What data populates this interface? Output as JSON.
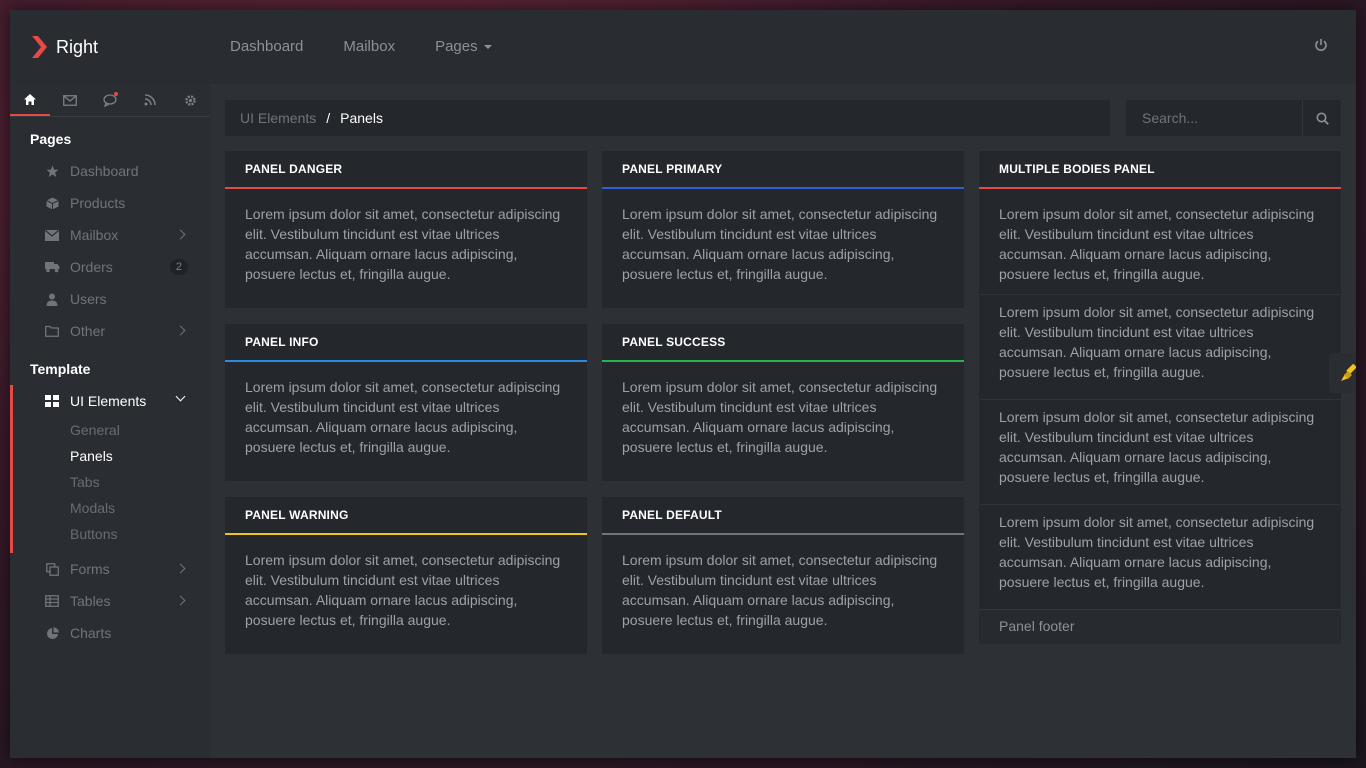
{
  "brand": {
    "name": "Right"
  },
  "topnav": {
    "items": [
      "Dashboard",
      "Mailbox",
      "Pages"
    ]
  },
  "sidebar": {
    "tabs": [
      "home-icon",
      "envelope-icon",
      "chat-icon",
      "rss-icon",
      "gear-icon"
    ],
    "pages_heading": "Pages",
    "pages": [
      {
        "label": "Dashboard",
        "icon": "star-icon"
      },
      {
        "label": "Products",
        "icon": "cube-icon"
      },
      {
        "label": "Mailbox",
        "icon": "envelope-icon",
        "chevron": true
      },
      {
        "label": "Orders",
        "icon": "truck-icon",
        "badge": "2"
      },
      {
        "label": "Users",
        "icon": "user-icon"
      },
      {
        "label": "Other",
        "icon": "folder-icon",
        "chevron": true
      }
    ],
    "template_heading": "Template",
    "ui_elements": {
      "label": "UI Elements",
      "children": [
        "General",
        "Panels",
        "Tabs",
        "Modals",
        "Buttons"
      ],
      "active_child": "Panels"
    },
    "template_items": [
      {
        "label": "Forms",
        "icon": "copy-icon",
        "chevron": true
      },
      {
        "label": "Tables",
        "icon": "table-icon",
        "chevron": true
      },
      {
        "label": "Charts",
        "icon": "pie-chart-icon"
      }
    ]
  },
  "breadcrumb": {
    "parent": "UI Elements",
    "separator": "/",
    "current": "Panels"
  },
  "search": {
    "placeholder": "Search..."
  },
  "lorem": "Lorem ipsum dolor sit amet, consectetur adipiscing elit. Vestibulum tincidunt est vitae ultrices accumsan. Aliquam ornare lacus adipiscing, posuere lectus et, fringilla augue.",
  "panels": {
    "danger": {
      "title": "PANEL DANGER",
      "color": "#e64a45"
    },
    "primary": {
      "title": "PANEL PRIMARY",
      "color": "#2f5fd0"
    },
    "info": {
      "title": "PANEL INFO",
      "color": "#2b8be0"
    },
    "success": {
      "title": "PANEL SUCCESS",
      "color": "#27b34d"
    },
    "warning": {
      "title": "PANEL WARNING",
      "color": "#f0c419"
    },
    "default": {
      "title": "PANEL DEFAULT",
      "color": "#6f757b"
    },
    "multiple": {
      "title": "MULTIPLE BODIES PANEL",
      "color": "#e64a45",
      "footer": "Panel footer"
    }
  },
  "colors": {
    "accent": "#e64a45",
    "background": "#2d3135",
    "panel": "#24272b"
  }
}
